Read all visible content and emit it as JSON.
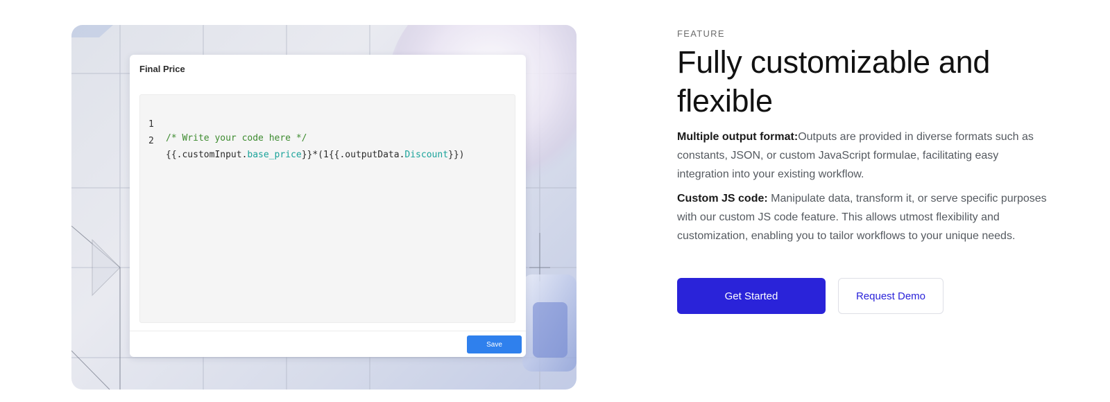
{
  "visual": {
    "editor": {
      "title": "Final Price",
      "code_lines": [
        {
          "number": "1",
          "comment": "/* Write your code here */"
        },
        {
          "number": "2",
          "tokens": [
            "{{.customInput.",
            "base_price",
            "}}*(1{{.outputData.",
            "Discount",
            "}})"
          ]
        }
      ],
      "save_label": "Save"
    }
  },
  "feature": {
    "eyebrow": "FEATURE",
    "headline": "Fully customizable and flexible",
    "paragraphs": [
      {
        "label": "Multiple output format:",
        "text": "Outputs are provided in diverse formats such as constants, JSON, or custom JavaScript formulae, facilitating easy integration into your existing workflow."
      },
      {
        "label": "Custom JS code:",
        "text": " Manipulate data, transform it, or serve specific purposes with our custom JS code feature. This allows utmost flexibility and customization, enabling you to tailor workflows to your unique needs."
      }
    ],
    "primary_cta": "Get Started",
    "secondary_cta": "Request Demo"
  },
  "colors": {
    "primary": "#2a23d9",
    "save_button": "#2f80ed",
    "code_comment": "#3d8b2f",
    "code_property": "#1aa39a"
  }
}
